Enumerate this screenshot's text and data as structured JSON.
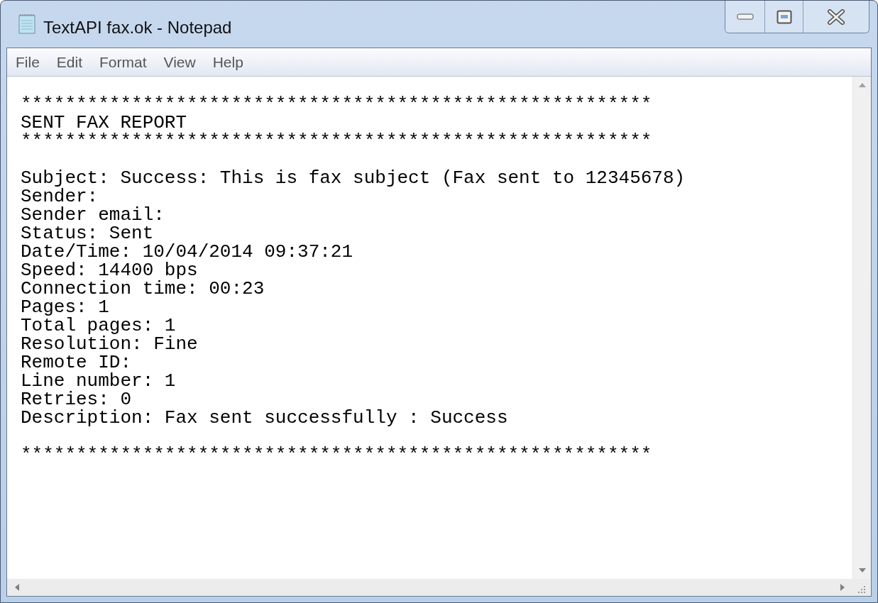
{
  "window": {
    "title": "TextAPI fax.ok - Notepad"
  },
  "menu": [
    "File",
    "Edit",
    "Format",
    "View",
    "Help"
  ],
  "document": {
    "paragraphs": [
      {
        "lines": [
          "*********************************************************",
          "SENT FAX REPORT",
          "*********************************************************"
        ]
      },
      {
        "lines": [
          "Subject: Success: This is fax subject (Fax sent to 12345678)",
          "Sender:",
          "Sender email:",
          "Status: Sent",
          "Date/Time: 10/04/2014 09:37:21",
          "Speed: 14400 bps",
          "Connection time: 00:23",
          "Pages: 1",
          "Total pages: 1",
          "Resolution: Fine",
          "Remote ID:",
          "Line number: 1",
          "Retries: 0",
          "Description: Fax sent successfully : Success"
        ]
      },
      {
        "lines": [
          "*********************************************************"
        ]
      }
    ]
  }
}
